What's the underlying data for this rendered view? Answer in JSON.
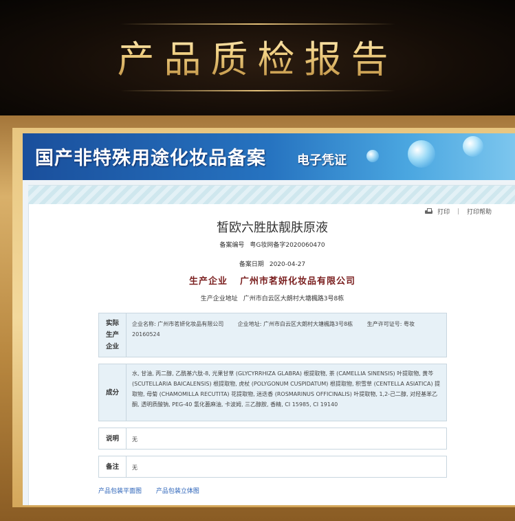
{
  "banner": {
    "title": "产品质检报告"
  },
  "header": {
    "title": "国产非特殊用途化妆品备案",
    "subtitle": "电子凭证"
  },
  "toolbar": {
    "print_label": "打印",
    "separator": "|",
    "print_help_label": "打印帮助"
  },
  "product": {
    "name": "皙欧六胜肽靓肤原液",
    "record_number_label": "备案编号",
    "record_number": "粤G妆网备字2020060470",
    "record_date_label": "备案日期",
    "record_date": "2020-04-27",
    "manufacturer_label": "生产企业",
    "manufacturer": "广州市茗妍化妆品有限公司",
    "address_label": "生产企业地址",
    "address": "广州市白云区大朗村大塘楓路3号8栋"
  },
  "sections": {
    "company": {
      "label": "实际生产企业",
      "name": "企业名称: 广州市茗妍化妆品有限公司",
      "address": "企业地址: 广州市白云区大朗村大塘楓路3号8栋",
      "license": "生产许可证号: 粤妆20160524"
    },
    "ingredients": {
      "label": "成分",
      "text": "水, 甘油, 丙二醇, 乙酰基六肽-8, 光果甘草 (GLYCYRRHIZA GLABRA) 根提取物, 茶 (CAMELLIA SINENSIS) 叶提取物, 黄芩 (SCUTELLARIA BAICALENSIS) 根提取物, 虎杖 (POLYGONUM CUSPIDATUM) 根提取物, 积雪草 (CENTELLA ASIATICA) 提取物, 母菊 (CHAMOMILLA RECUTITA) 花提取物, 迷迭香 (ROSMARINUS OFFICINALIS) 叶提取物, 1,2-己二醇, 对羟基苯乙酮, 透明质酸钠, PEG-40 氢化蓖麻油, 卡波姆, 三乙醇胺, 香精, CI 15985, CI 19140"
    },
    "note": {
      "label": "说明",
      "value": "无"
    },
    "remark": {
      "label": "备注",
      "value": "无"
    }
  },
  "links": {
    "flat_image": "产品包装平面图",
    "3d_image": "产品包装立体图"
  },
  "colors": {
    "gold": "#f0cf82",
    "header_blue": "#2673c0",
    "company_red": "#7a1f1f",
    "link_blue": "#2a62b8"
  }
}
